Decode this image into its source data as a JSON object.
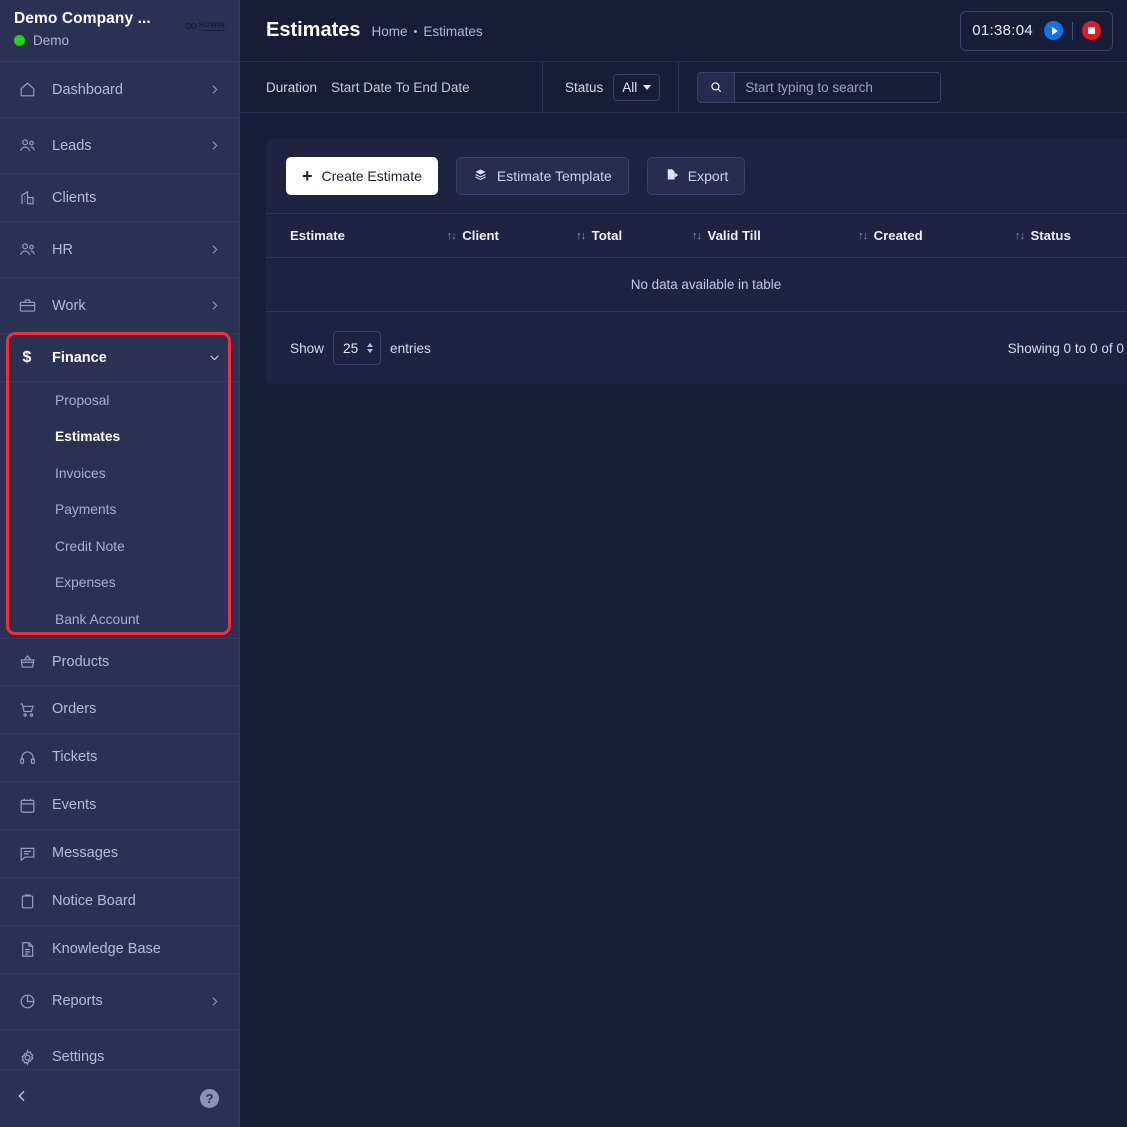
{
  "sidebar": {
    "company_name": "Demo Company ...",
    "status_label": "Demo",
    "logo_mark": "OO",
    "logo_text": "HOWIN",
    "items": [
      {
        "label": "Dashboard",
        "icon": "home-icon",
        "has_chevron": true
      },
      {
        "label": "Leads",
        "icon": "users-icon",
        "has_chevron": true
      },
      {
        "label": "Clients",
        "icon": "building-icon",
        "has_chevron": false
      },
      {
        "label": "HR",
        "icon": "users-icon",
        "has_chevron": true
      },
      {
        "label": "Work",
        "icon": "briefcase-icon",
        "has_chevron": true
      }
    ],
    "finance": {
      "label": "Finance",
      "icon": "dollar-icon",
      "expanded": true,
      "submenu": [
        {
          "label": "Proposal",
          "active": false
        },
        {
          "label": "Estimates",
          "active": true
        },
        {
          "label": "Invoices",
          "active": false
        },
        {
          "label": "Payments",
          "active": false
        },
        {
          "label": "Credit Note",
          "active": false
        },
        {
          "label": "Expenses",
          "active": false
        },
        {
          "label": "Bank Account",
          "active": false
        }
      ],
      "highlight_color": "#fa2b35"
    },
    "items_lower": [
      {
        "label": "Products",
        "icon": "basket-icon",
        "has_chevron": false
      },
      {
        "label": "Orders",
        "icon": "cart-icon",
        "has_chevron": false
      },
      {
        "label": "Tickets",
        "icon": "headset-icon",
        "has_chevron": false
      },
      {
        "label": "Events",
        "icon": "calendar-icon",
        "has_chevron": false
      },
      {
        "label": "Messages",
        "icon": "chat-icon",
        "has_chevron": false
      },
      {
        "label": "Notice Board",
        "icon": "clipboard-icon",
        "has_chevron": false
      },
      {
        "label": "Knowledge Base",
        "icon": "document-icon",
        "has_chevron": false
      },
      {
        "label": "Reports",
        "icon": "pie-chart-icon",
        "has_chevron": true
      },
      {
        "label": "Settings",
        "icon": "gear-icon",
        "has_chevron": false
      }
    ],
    "footer": {
      "collapse_icon": "chevron-left-icon",
      "help_label": "?"
    }
  },
  "header": {
    "title": "Estimates",
    "breadcrumb_home": "Home",
    "breadcrumb_sep": "•",
    "breadcrumb_current": "Estimates",
    "timer": "01:38:04",
    "play_icon": "play-icon",
    "stop_icon": "stop-icon"
  },
  "filters": {
    "duration_label": "Duration",
    "duration_value": "Start Date To End Date",
    "status_label": "Status",
    "status_value": "All",
    "search_icon": "search-icon",
    "search_value": "",
    "search_placeholder": "Start typing to search"
  },
  "toolbar": {
    "create_label": "Create Estimate",
    "create_icon": "plus-icon",
    "template_label": "Estimate Template",
    "template_icon": "layers-icon",
    "export_label": "Export",
    "export_icon": "file-export-icon"
  },
  "table": {
    "columns": [
      "Estimate",
      "Client",
      "Total",
      "Valid Till",
      "Created",
      "Status"
    ],
    "rows": [],
    "empty_message": "No data available in table"
  },
  "pagination": {
    "show_label": "Show",
    "entries_value": "25",
    "entries_label": "entries",
    "showing_text": "Showing 0 to 0 of 0"
  },
  "colors": {
    "sidebar_bg": "#2b3153",
    "main_bg": "#171d36",
    "card_bg": "#1d2340",
    "accent_red": "#fa2b35",
    "accent_blue": "#1272e8",
    "status_green": "#22d411"
  }
}
